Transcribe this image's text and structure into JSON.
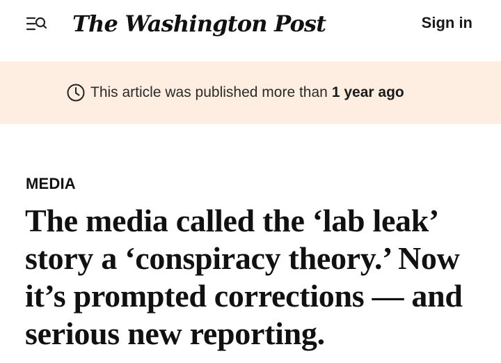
{
  "header": {
    "brand": "The Washington Post",
    "sign_in_label": "Sign in",
    "menu_icon": "menu-search-icon"
  },
  "notice": {
    "icon": "clock-icon",
    "text": "This article was published more than",
    "emphasis": "1 year ago",
    "background": "#fdeee1"
  },
  "article": {
    "section": "MEDIA",
    "headline": "The media called the ‘lab leak’ story a ‘conspiracy theory.’ Now it’s prompted corrections — and serious new reporting."
  }
}
